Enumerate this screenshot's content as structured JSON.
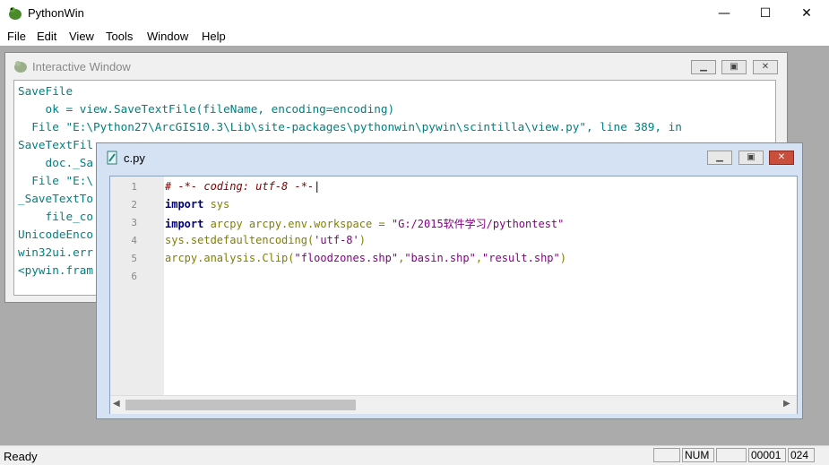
{
  "app": {
    "title": "PythonWin",
    "window_controls": {
      "minimize": "—",
      "maximize": "☐",
      "close": "✕"
    }
  },
  "menubar": [
    {
      "label": "File"
    },
    {
      "label": "Edit"
    },
    {
      "label": "View"
    },
    {
      "label": "Tools"
    },
    {
      "label": "Window"
    },
    {
      "label": "Help"
    }
  ],
  "interactive_window": {
    "title": "Interactive Window",
    "lines": [
      "SaveFile",
      "    ok = view.SaveTextFile(fileName, encoding=encoding)",
      "  File \"E:\\Python27\\ArcGIS10.3\\Lib\\site-packages\\pythonwin\\pywin\\scintilla\\view.py\", line 389, in",
      "SaveTextFil",
      "    doc._Sa",
      "  File \"E:\\",
      "_SaveTextTo",
      "    file_co",
      "UnicodeEnco",
      "win32ui.err",
      "<pywin.fram"
    ]
  },
  "editor_window": {
    "title": "c.py",
    "line_numbers": [
      "1",
      "2",
      "3",
      "4",
      "5",
      "6"
    ],
    "code": {
      "l1_comment": "# -*- coding: utf-8 -*-",
      "l2_kw": "import",
      "l2_rest": " sys",
      "l3_kw": "import",
      "l3_a": " arcpy arcpy.env.workspace = ",
      "l3_str": "\"G:/2015软件学习/pythontest\"",
      "l4_a": "sys.setdefaultencoding(",
      "l4_str": "'utf-8'",
      "l4_b": ")",
      "l5_a": "arcpy.analysis.Clip(",
      "l5_s1": "\"floodzones.shp\"",
      "l5_c1": ",",
      "l5_s2": "\"basin.shp\"",
      "l5_c2": ",",
      "l5_s3": "\"result.shp\"",
      "l5_b": ")"
    }
  },
  "statusbar": {
    "text": "Ready",
    "num": "NUM",
    "line": "00001",
    "col": "024"
  }
}
